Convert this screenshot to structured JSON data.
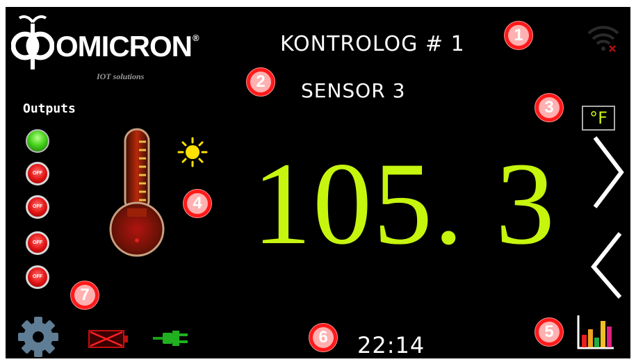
{
  "header": {
    "brand": "OMICRON",
    "brand_mark": "®",
    "brand_subtitle": "IOT solutions",
    "device_title": "KONTROLOG # 1",
    "sensor_label": "SENSOR 3",
    "wifi_icon": "wifi-disconnected-icon"
  },
  "outputs": {
    "label": "Outputs",
    "items": [
      {
        "state": "on",
        "text": ""
      },
      {
        "state": "off",
        "text": "OFF"
      },
      {
        "state": "off",
        "text": "OFF"
      },
      {
        "state": "off",
        "text": "OFF"
      },
      {
        "state": "off",
        "text": "OFF"
      }
    ]
  },
  "reading": {
    "value": "105. 3",
    "unit": "°F"
  },
  "status": {
    "time": "22:14",
    "settings_icon": "gear-icon",
    "battery_icon": "battery-empty-icon",
    "power_icon": "plug-icon",
    "chart_icon": "bar-chart-icon",
    "sun_icon": "sun-icon",
    "thermometer_icon": "thermometer-icon"
  },
  "badges": [
    "1",
    "2",
    "3",
    "4",
    "5",
    "6",
    "7"
  ],
  "colors": {
    "accent": "#c6f50e",
    "badge": "#ff1a1a",
    "background": "#000000"
  }
}
